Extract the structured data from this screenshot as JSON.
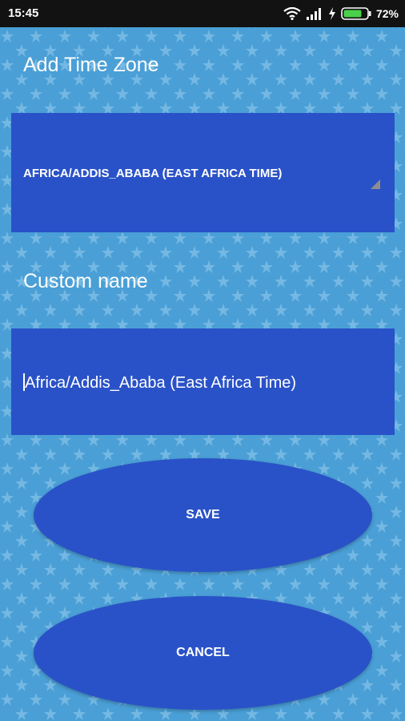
{
  "status_bar": {
    "time": "15:45",
    "battery_percent": "72%",
    "icons": [
      "wifi-icon",
      "signal-icon",
      "charging-icon",
      "battery-icon"
    ]
  },
  "page": {
    "title": "Add Time Zone",
    "custom_name_label": "Custom name"
  },
  "timezone_spinner": {
    "selected": "AFRICA/ADDIS_ABABA (EAST AFRICA TIME)"
  },
  "custom_name_field": {
    "value": "Africa/Addis_Ababa (East Africa Time)"
  },
  "buttons": {
    "save_label": "SAVE",
    "cancel_label": "CANCEL"
  },
  "colors": {
    "background": "#4a9fd6",
    "star_pattern": "#74b8e3",
    "panel": "#2a52c8",
    "status_bar": "#121212",
    "battery_fill": "#49d14a"
  }
}
